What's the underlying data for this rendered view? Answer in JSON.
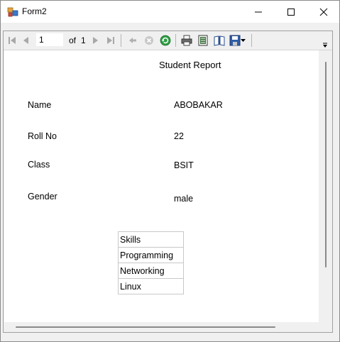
{
  "window": {
    "title": "Form2"
  },
  "toolbar": {
    "current_page": "1",
    "of_label": "of",
    "total_pages": "1"
  },
  "report": {
    "title": "Student Report",
    "fields": [
      {
        "label": "Name",
        "value": "ABOBAKAR"
      },
      {
        "label": "Roll No",
        "value": "22"
      },
      {
        "label": "Class",
        "value": "BSIT"
      },
      {
        "label": "Gender",
        "value": "male"
      }
    ],
    "skills_table": {
      "header": "Skills",
      "rows": [
        "Programming",
        "Networking",
        "Linux"
      ]
    }
  }
}
